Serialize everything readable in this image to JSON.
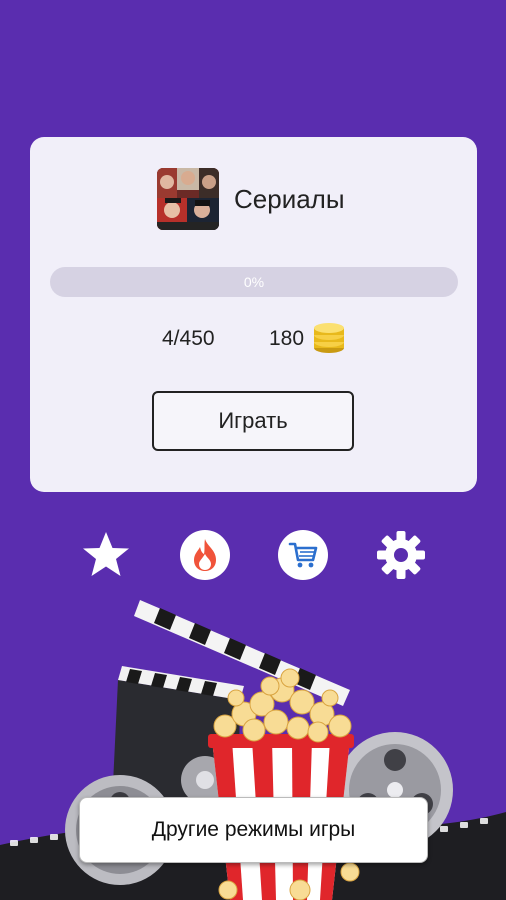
{
  "card": {
    "category_label": "Сериалы",
    "progress": {
      "percent": 0,
      "label": "0%"
    },
    "levels": "4/450",
    "coins": "180",
    "play_label": "Играть"
  },
  "nav_icons": [
    {
      "name": "favorites",
      "icon": "star-icon"
    },
    {
      "name": "popular",
      "icon": "fire-icon"
    },
    {
      "name": "shop",
      "icon": "cart-icon"
    },
    {
      "name": "settings",
      "icon": "gear-icon"
    }
  ],
  "other_modes_label": "Другие режимы игры",
  "colors": {
    "background": "#5a2daf",
    "card": "#f1eff9",
    "progress_track": "#d6d2e3",
    "fire": "#f0533a",
    "cart": "#2b6fce"
  }
}
